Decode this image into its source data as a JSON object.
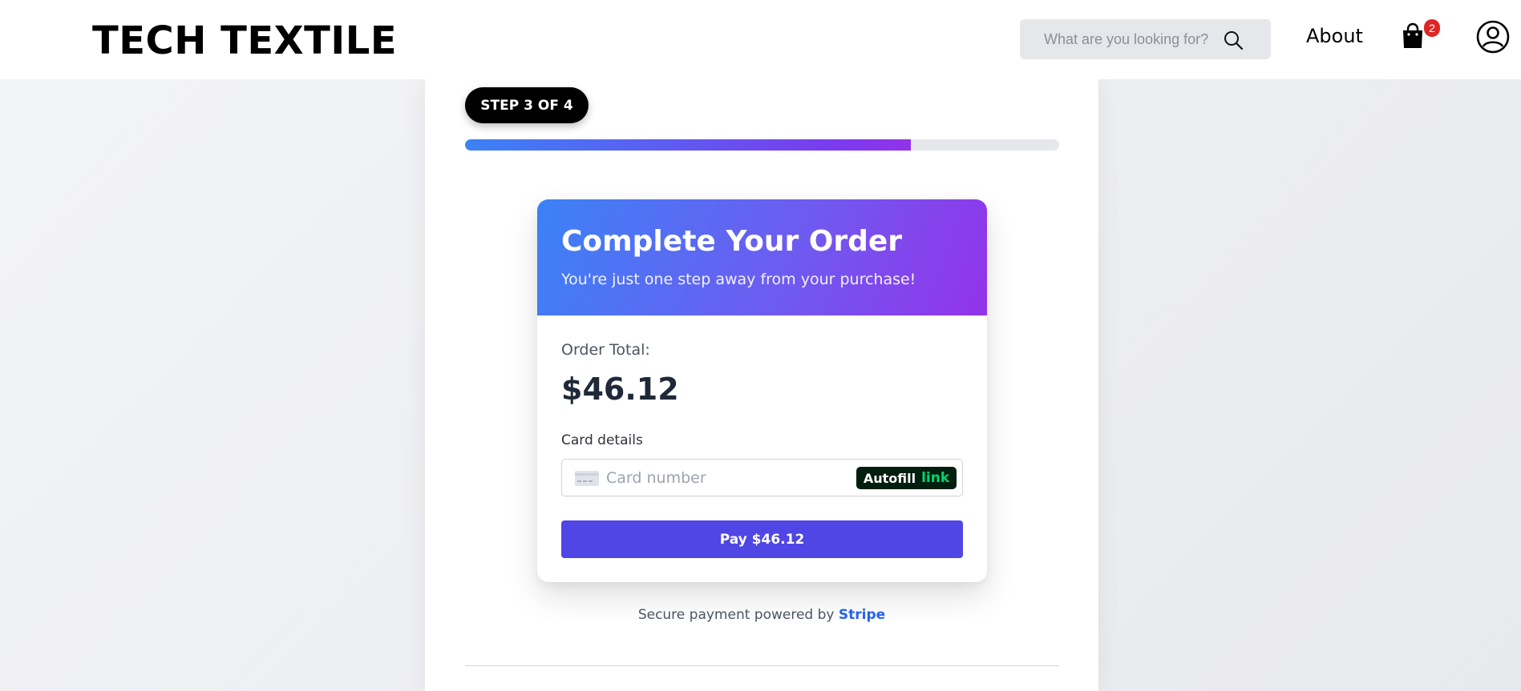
{
  "header": {
    "brand": "TECH TEXTILE",
    "search_placeholder": "What are you looking for?",
    "about_label": "About",
    "cart_count": "2"
  },
  "checkout": {
    "step_label": "STEP 3 OF 4",
    "progress_fraction": 0.75,
    "card_title": "Complete Your Order",
    "card_subtitle": "You're just one step away from your purchase!",
    "order_total_label": "Order Total:",
    "order_total_value": "$46.12",
    "card_details_label": "Card details",
    "card_number_placeholder": "Card number",
    "autofill_label": "Autofill",
    "autofill_link": "link",
    "pay_button_label": "Pay $46.12",
    "secure_text": "Secure payment powered by",
    "secure_provider": "Stripe"
  },
  "colors": {
    "accent_blue": "#3b82f6",
    "accent_purple": "#9333ea",
    "pay_button": "#4f46e5",
    "badge": "#dc2626",
    "link_green": "#00d66f"
  }
}
